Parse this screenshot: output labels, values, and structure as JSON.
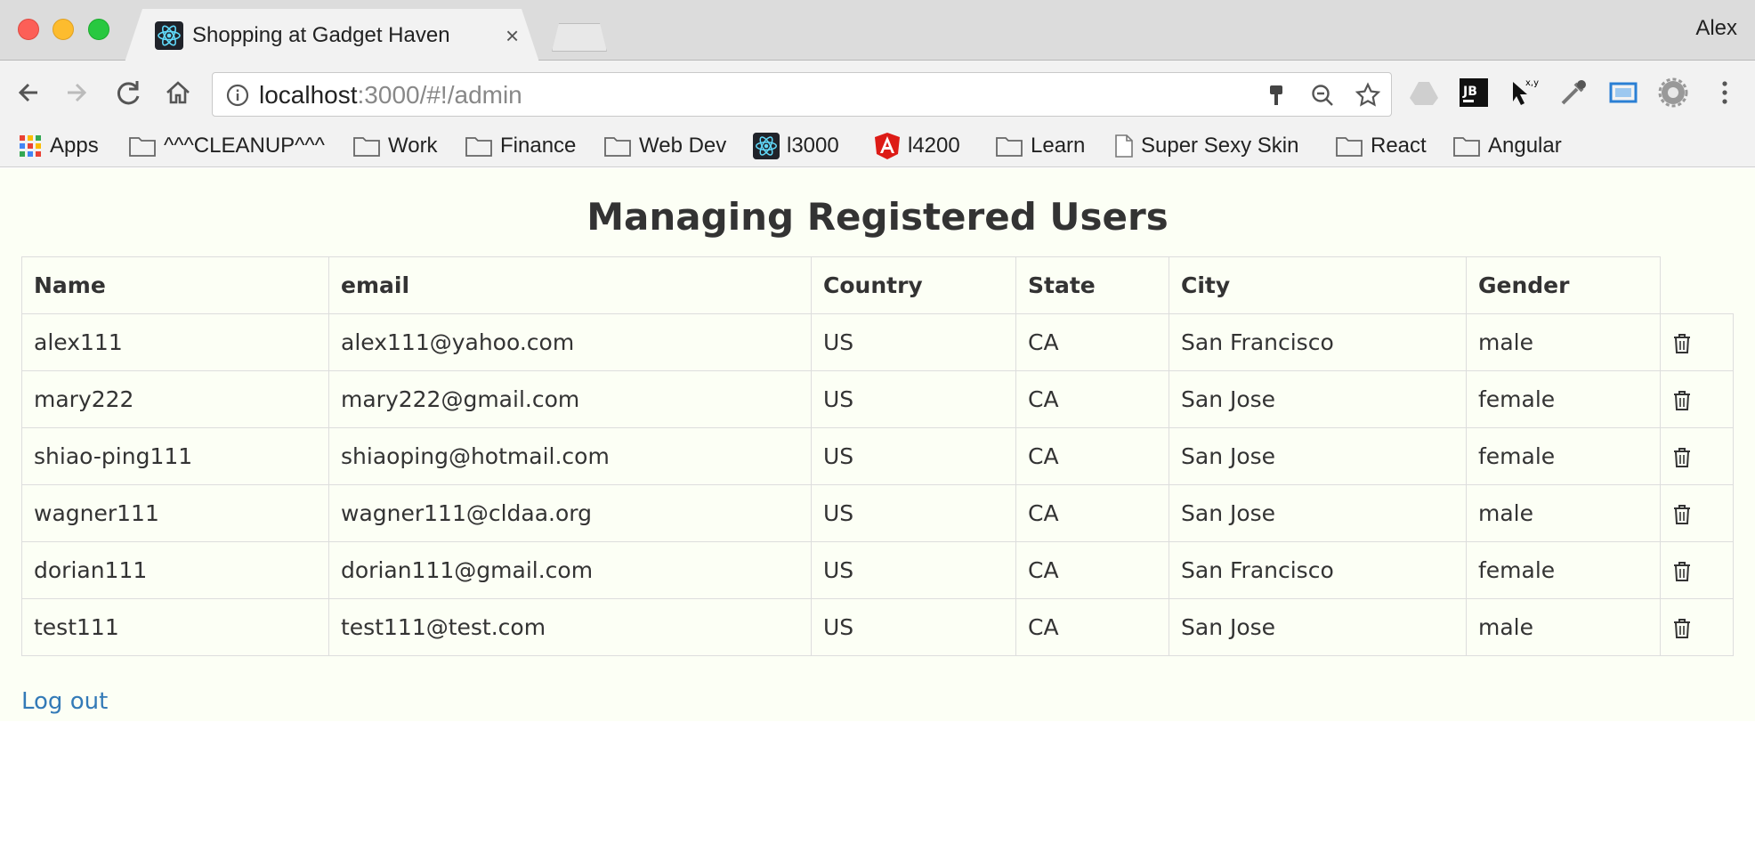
{
  "browser": {
    "tab_title": "Shopping at Gadget Haven",
    "tab_close": "×",
    "profile_name": "Alex",
    "url_host": "localhost",
    "url_rest": ":3000/#!/admin",
    "bookmarks": [
      {
        "label": "Apps",
        "icon": "apps-grid-icon"
      },
      {
        "label": "^^^CLEANUP^^^",
        "icon": "folder-icon"
      },
      {
        "label": "Work",
        "icon": "folder-icon"
      },
      {
        "label": "Finance",
        "icon": "folder-icon"
      },
      {
        "label": "Web Dev",
        "icon": "folder-icon"
      },
      {
        "label": "l3000",
        "icon": "react-icon"
      },
      {
        "label": "l4200",
        "icon": "angular-icon"
      },
      {
        "label": "Learn",
        "icon": "folder-icon"
      },
      {
        "label": "Super Sexy Skin",
        "icon": "page-icon"
      },
      {
        "label": "React",
        "icon": "folder-icon"
      },
      {
        "label": "Angular",
        "icon": "folder-icon"
      }
    ],
    "extension_icons": [
      "drive-icon",
      "jetbrains-icon",
      "cursor-xy-icon",
      "eyedropper-icon",
      "screen-capture-icon",
      "gear-icon",
      "more-menu-icon"
    ]
  },
  "page": {
    "heading": "Managing Registered Users",
    "columns": [
      "Name",
      "email",
      "Country",
      "State",
      "City",
      "Gender"
    ],
    "users": [
      {
        "name": "alex111",
        "email": "alex111@yahoo.com",
        "country": "US",
        "state": "CA",
        "city": "San Francisco",
        "gender": "male"
      },
      {
        "name": "mary222",
        "email": "mary222@gmail.com",
        "country": "US",
        "state": "CA",
        "city": "San Jose",
        "gender": "female"
      },
      {
        "name": "shiao-ping111",
        "email": "shiaoping@hotmail.com",
        "country": "US",
        "state": "CA",
        "city": "San Jose",
        "gender": "female"
      },
      {
        "name": "wagner111",
        "email": "wagner111@cldaa.org",
        "country": "US",
        "state": "CA",
        "city": "San Jose",
        "gender": "male"
      },
      {
        "name": "dorian111",
        "email": "dorian111@gmail.com",
        "country": "US",
        "state": "CA",
        "city": "San Francisco",
        "gender": "female"
      },
      {
        "name": "test111",
        "email": "test111@test.com",
        "country": "US",
        "state": "CA",
        "city": "San Jose",
        "gender": "male"
      }
    ],
    "logout_label": "Log out",
    "colors": {
      "page_bg": "#fcfff5",
      "link": "#337ab7",
      "text": "#333333"
    }
  }
}
